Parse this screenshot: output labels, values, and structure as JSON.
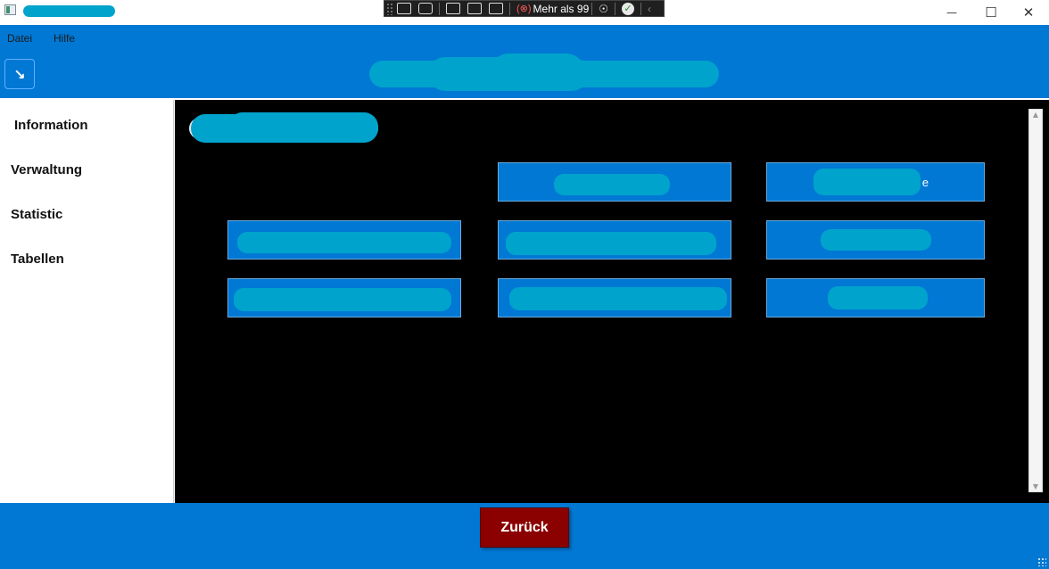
{
  "titlebar": {
    "title_redacted": true,
    "controls": {
      "minimize": "—",
      "maximize": "☐",
      "close": "✕"
    }
  },
  "debug_toolbar": {
    "counter_text": "Mehr als 99",
    "counter_icon": "(⊗)",
    "accessibility_icon": "☉",
    "check_icon": "✓",
    "collapse_icon": "‹"
  },
  "menu": {
    "items": [
      "Datei",
      "Hilfe"
    ]
  },
  "header": {
    "nav_icon": "↘",
    "title_redacted": true
  },
  "sidebar": {
    "items": [
      "Information",
      "Verwaltung",
      "Statistic",
      "Tabellen"
    ]
  },
  "main": {
    "heading_redacted": true,
    "tile_tail_text": "e"
  },
  "scrollbar": {
    "up": "▲",
    "down": "▼"
  },
  "footer": {
    "back_label": "Zurück"
  },
  "colors": {
    "accent": "#0078d4",
    "redaction": "#00a3cc",
    "content_bg": "#000000",
    "back_button": "#8b0000"
  }
}
